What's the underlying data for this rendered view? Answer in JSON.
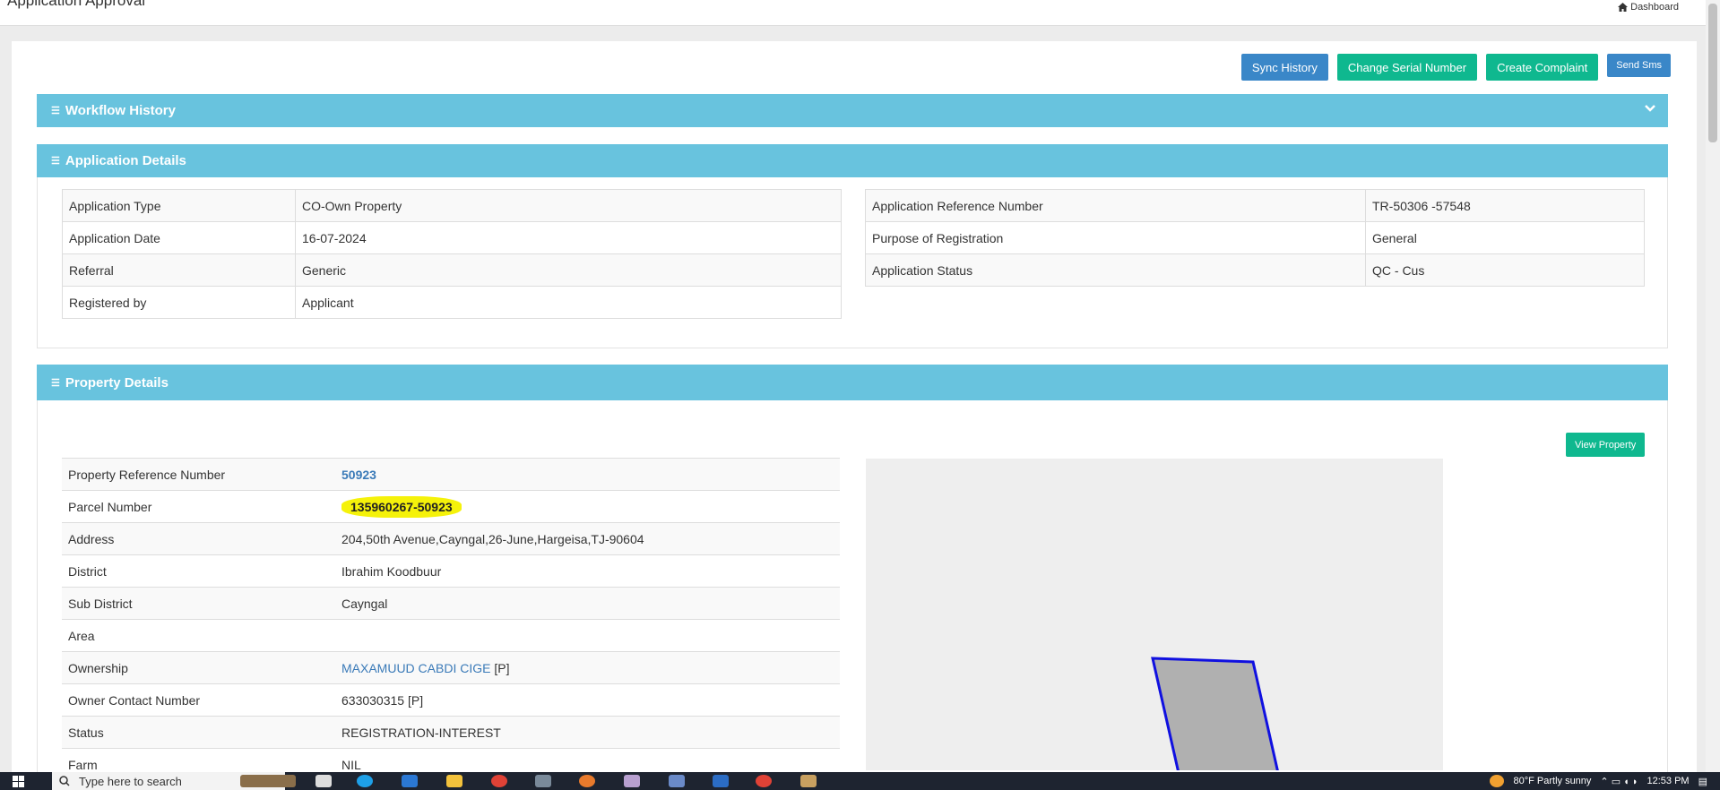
{
  "header": {
    "title": "Application Approval",
    "breadcrumb": "Dashboard"
  },
  "actions": {
    "sync": "Sync History",
    "change_serial": "Change Serial Number",
    "complaint": "Create Complaint",
    "sms": "Send Sms"
  },
  "sections": {
    "workflow": "Workflow History",
    "application": "Application Details",
    "property": "Property Details"
  },
  "application_details": {
    "left": [
      {
        "label": "Application Type",
        "value": "CO-Own Property"
      },
      {
        "label": "Application Date",
        "value": "16-07-2024"
      },
      {
        "label": "Referral",
        "value": "Generic"
      },
      {
        "label": "Registered by",
        "value": "Applicant"
      }
    ],
    "right": [
      {
        "label": "Application Reference Number",
        "value": "TR-50306 -57548"
      },
      {
        "label": "Purpose of Registration",
        "value": "General"
      },
      {
        "label": "Application Status",
        "value": "QC - Cus"
      }
    ]
  },
  "property_details": {
    "view_button": "View Property",
    "rows": [
      {
        "label": "Property Reference Number",
        "value": "50923"
      },
      {
        "label": "Parcel Number",
        "value": "135960267-50923"
      },
      {
        "label": "Address",
        "value": "204,50th Avenue,Cayngal,26-June,Hargeisa,TJ-90604"
      },
      {
        "label": "District",
        "value": "Ibrahim Koodbuur"
      },
      {
        "label": "Sub District",
        "value": "Cayngal"
      },
      {
        "label": "Area",
        "value": ""
      },
      {
        "label": "Ownership",
        "value": "MAXAMUUD CABDI CIGE",
        "suffix": "[P]"
      },
      {
        "label": "Owner Contact Number",
        "value": "633030315 [P]"
      },
      {
        "label": "Status",
        "value": "REGISTRATION-INTEREST"
      },
      {
        "label": "Farm",
        "value": "NIL"
      }
    ]
  },
  "taskbar": {
    "search_placeholder": "Type here to search",
    "weather": "80°F  Partly sunny",
    "time": "12:53 PM"
  }
}
